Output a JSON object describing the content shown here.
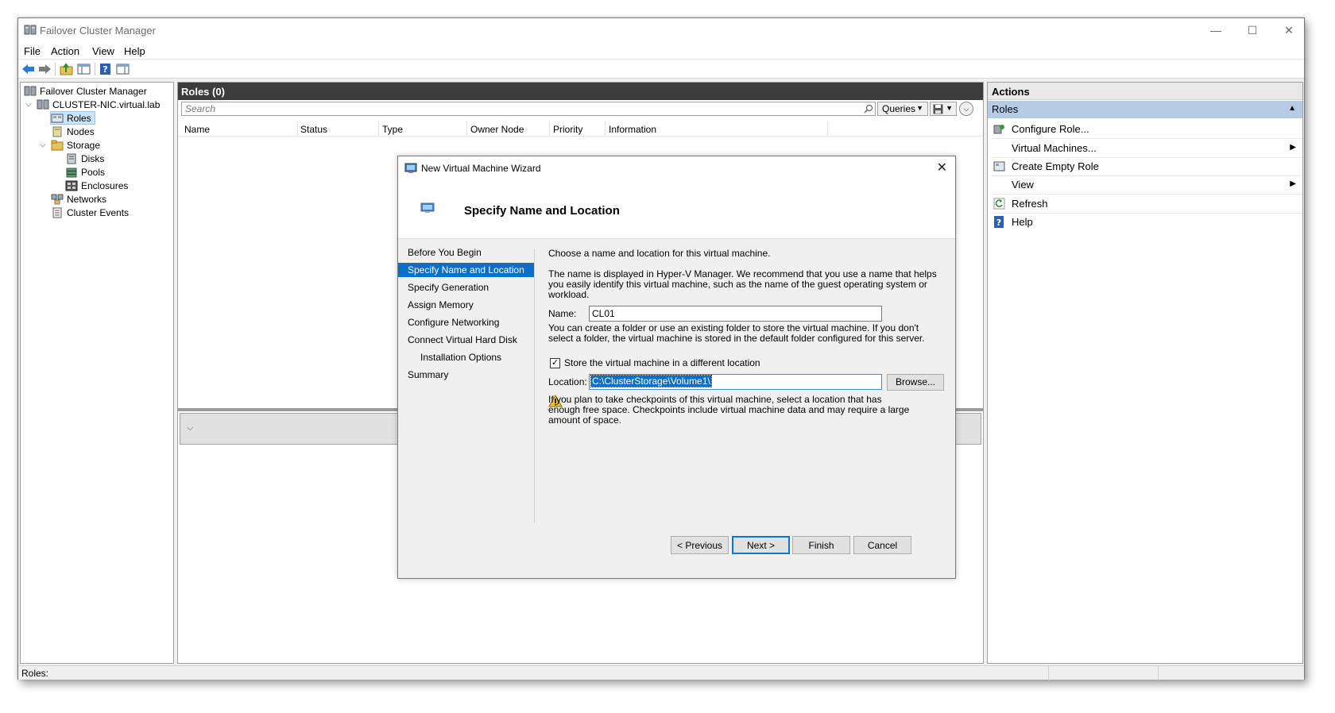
{
  "app": {
    "title": "Failover Cluster Manager"
  },
  "window_controls": {
    "minimize": "—",
    "maximize": "☐",
    "close": "✕"
  },
  "menu": [
    "File",
    "Action",
    "View",
    "Help"
  ],
  "tree": {
    "root": "Failover Cluster Manager",
    "cluster": "CLUSTER-NIC.virtual.lab",
    "items": {
      "roles": "Roles",
      "nodes": "Nodes",
      "storage": "Storage",
      "disks": "Disks",
      "pools": "Pools",
      "enclosures": "Enclosures",
      "networks": "Networks",
      "events": "Cluster Events"
    }
  },
  "center": {
    "heading": "Roles (0)",
    "search_placeholder": "Search",
    "queries_label": "Queries",
    "columns": [
      "Name",
      "Status",
      "Type",
      "Owner Node",
      "Priority",
      "Information"
    ]
  },
  "actions": {
    "heading": "Actions",
    "section": "Roles",
    "items": {
      "configure_role": "Configure Role...",
      "virtual_machines": "Virtual Machines...",
      "create_empty_role": "Create Empty Role",
      "view": "View",
      "refresh": "Refresh",
      "help": "Help"
    }
  },
  "status": {
    "text": "Roles:"
  },
  "wizard": {
    "title": "New Virtual Machine Wizard",
    "heading": "Specify Name and Location",
    "steps": {
      "before": "Before You Begin",
      "name_location": "Specify Name and Location",
      "generation": "Specify Generation",
      "memory": "Assign Memory",
      "networking": "Configure Networking",
      "vhd": "Connect Virtual Hard Disk",
      "install": "Installation Options",
      "summary": "Summary"
    },
    "intro": "Choose a name and location for this virtual machine.",
    "name_help": "The name is displayed in Hyper-V Manager. We recommend that you use a name that helps you easily identify this virtual machine, such as the name of the guest operating system or workload.",
    "name_label": "Name:",
    "name_value": "CL01",
    "folder_help": "You can create a folder or use an existing folder to store the virtual machine. If you don't select a folder, the virtual machine is stored in the default folder configured for this server.",
    "store_checkbox_label": "Store the virtual machine in a different location",
    "store_checked_glyph": "✓",
    "location_label": "Location:",
    "location_value": "C:\\ClusterStorage\\Volume1\\",
    "browse_label": "Browse...",
    "warning": "If you plan to take checkpoints of this virtual machine, select a location that has enough free space. Checkpoints include virtual machine data and may require a large amount of space.",
    "buttons": {
      "previous": "< Previous",
      "next": "Next >",
      "finish": "Finish",
      "cancel": "Cancel"
    }
  }
}
